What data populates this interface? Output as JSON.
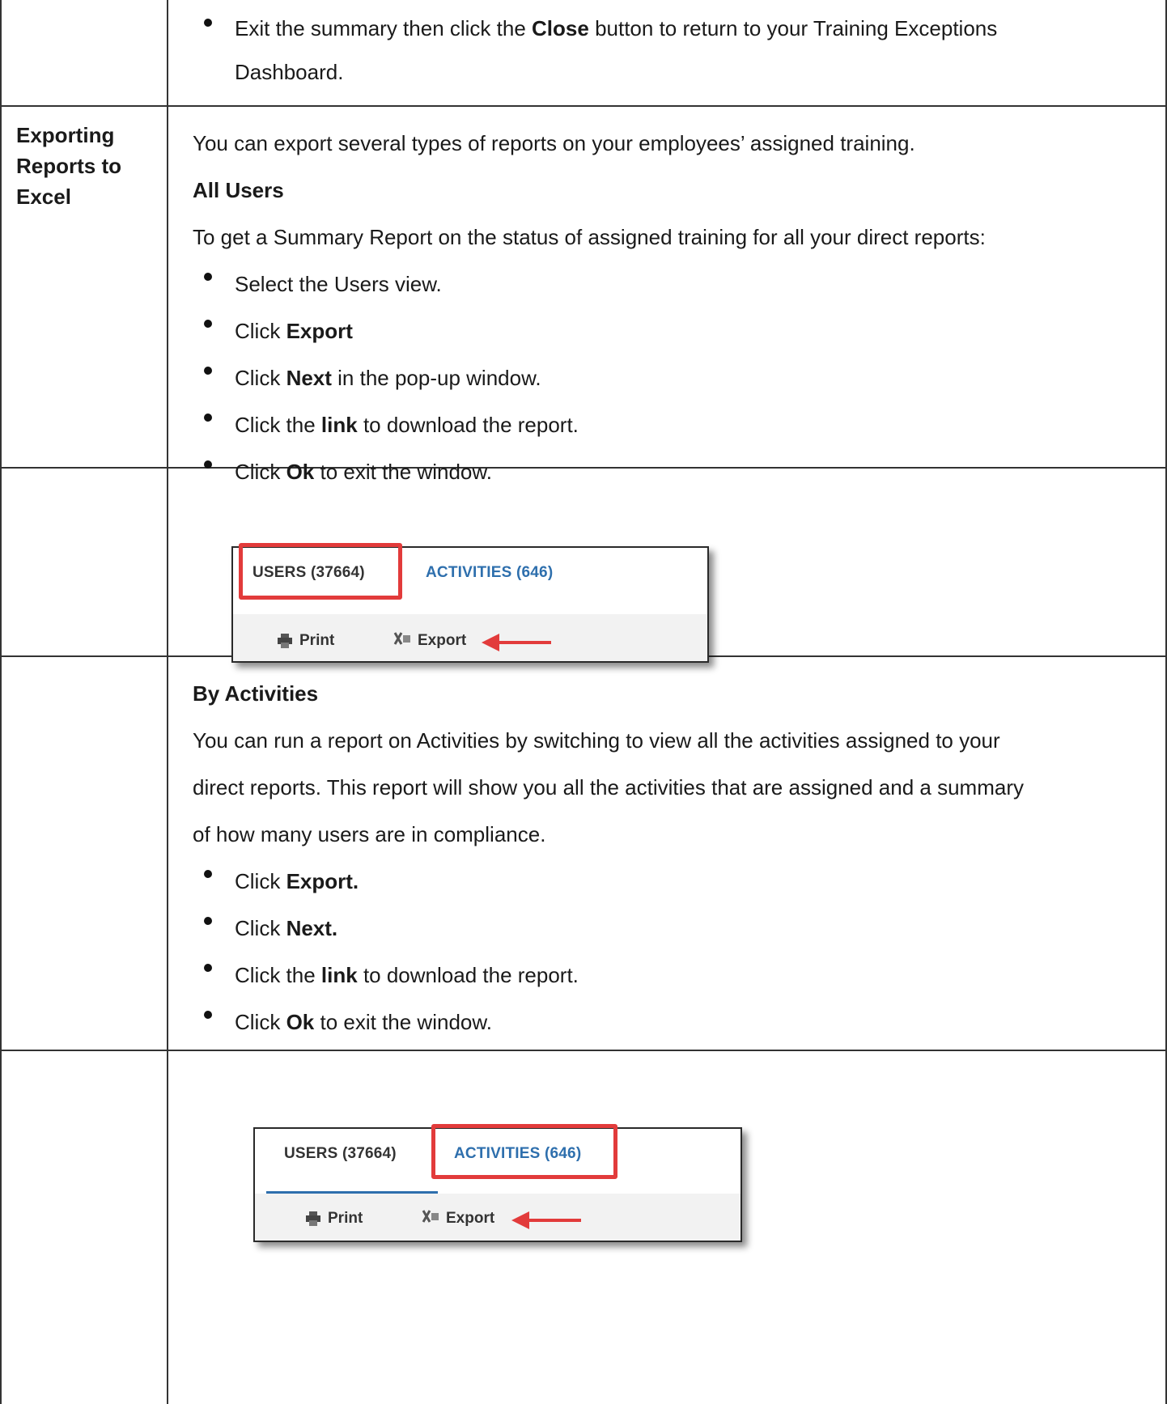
{
  "top_bullet": {
    "prefix": "Exit the summary then click the ",
    "bold": "Close",
    "suffix": " button to return to your Training Exceptions",
    "line2": "Dashboard."
  },
  "section": {
    "label": "Exporting Reports to Excel",
    "intro": "You can export several types of reports on your employees’ assigned training.",
    "all_users_heading": "All Users",
    "all_users_desc": "To get a Summary Report on the status of assigned training for all your direct reports:",
    "all_users_steps": [
      {
        "pre": "Select the Users view.",
        "bold": "",
        "post": ""
      },
      {
        "pre": "Click ",
        "bold": "Export",
        "post": ""
      },
      {
        "pre": "Click ",
        "bold": "Next",
        "post": " in the pop-up window."
      },
      {
        "pre": "Click the ",
        "bold": "link",
        "post": " to download the report."
      },
      {
        "pre": "Click ",
        "bold": "Ok",
        "post": " to exit the window."
      }
    ],
    "by_activities_heading": "By Activities",
    "by_activities_desc_1": "You can run a report on Activities by switching to view all the activities assigned to your",
    "by_activities_desc_2": "direct reports. This report will show you all the activities that are assigned and a summary",
    "by_activities_desc_3": "of how many users are in compliance.",
    "by_activities_steps": [
      {
        "pre": "Click ",
        "bold": "Export.",
        "post": ""
      },
      {
        "pre": "Click ",
        "bold": "Next.",
        "post": ""
      },
      {
        "pre": "Click the ",
        "bold": "link",
        "post": " to download the report."
      },
      {
        "pre": "Click ",
        "bold": "Ok",
        "post": " to exit the window."
      }
    ]
  },
  "screenshot": {
    "users_tab": "USERS (37664)",
    "activities_tab": "ACTIVITIES (646)",
    "print_label": "Print",
    "export_label": "Export",
    "highlight_color": "#e23b3b",
    "link_color": "#2e6fad"
  }
}
